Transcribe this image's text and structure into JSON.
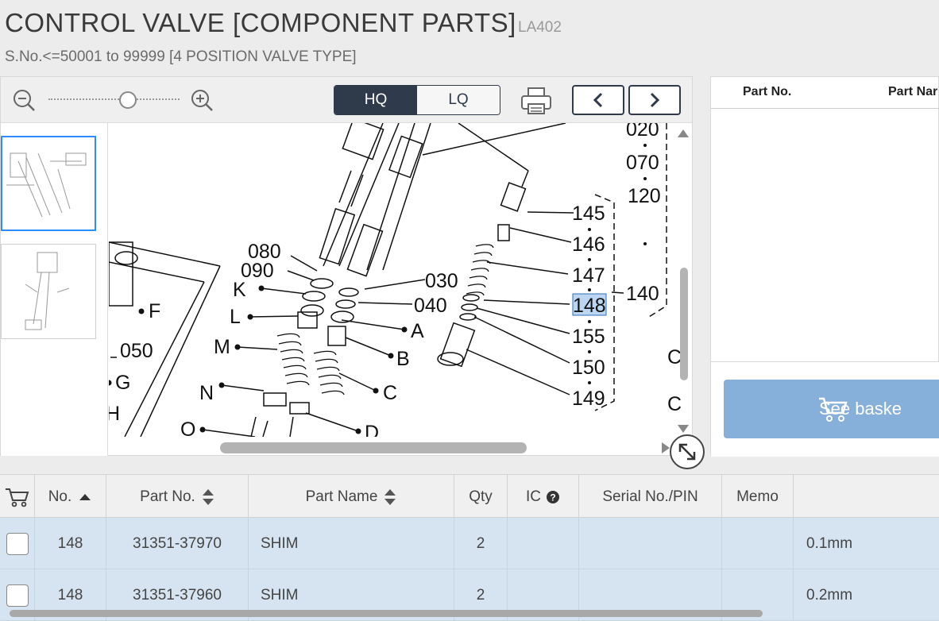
{
  "header": {
    "title": "CONTROL VALVE [COMPONENT PARTS]",
    "model_code": "LA402",
    "subtitle": "S.No.<=50001 to 99999 [4 POSITION VALVE TYPE]"
  },
  "toolbar": {
    "quality_options": [
      "HQ",
      "LQ"
    ],
    "selected_quality": "HQ",
    "zoom_level_fraction": 0.6
  },
  "diagram": {
    "labels": [
      "020",
      "070",
      "120",
      "145",
      "146",
      "147",
      "148",
      "155",
      "150",
      "149",
      "140",
      "080",
      "090",
      "030",
      "040",
      "K",
      "L",
      "M",
      "N",
      "O",
      "A",
      "B",
      "C",
      "D",
      "F",
      "G",
      "H",
      "050"
    ],
    "highlighted_label": "148"
  },
  "right_panel": {
    "col_part_no": "Part No.",
    "col_part_name": "Part Nar",
    "basket_button": "See baske"
  },
  "table": {
    "headers": {
      "no": "No.",
      "part_no": "Part No.",
      "part_name": "Part Name",
      "qty": "Qty",
      "ic": "IC",
      "serial": "Serial No./PIN",
      "memo": "Memo"
    },
    "rows": [
      {
        "no": "148",
        "part_no": "31351-37970",
        "part_name": "SHIM",
        "qty": "2",
        "ic": "",
        "serial": "",
        "memo": "",
        "remarks": "0.1mm"
      },
      {
        "no": "148",
        "part_no": "31351-37960",
        "part_name": "SHIM",
        "qty": "2",
        "ic": "",
        "serial": "",
        "memo": "",
        "remarks": "0.2mm"
      }
    ]
  },
  "colors": {
    "accent_dark": "#2f3a4b",
    "row_selected": "#d6e4f2",
    "basket_button": "#86afd9",
    "thumb_selected": "#2d8cff"
  }
}
